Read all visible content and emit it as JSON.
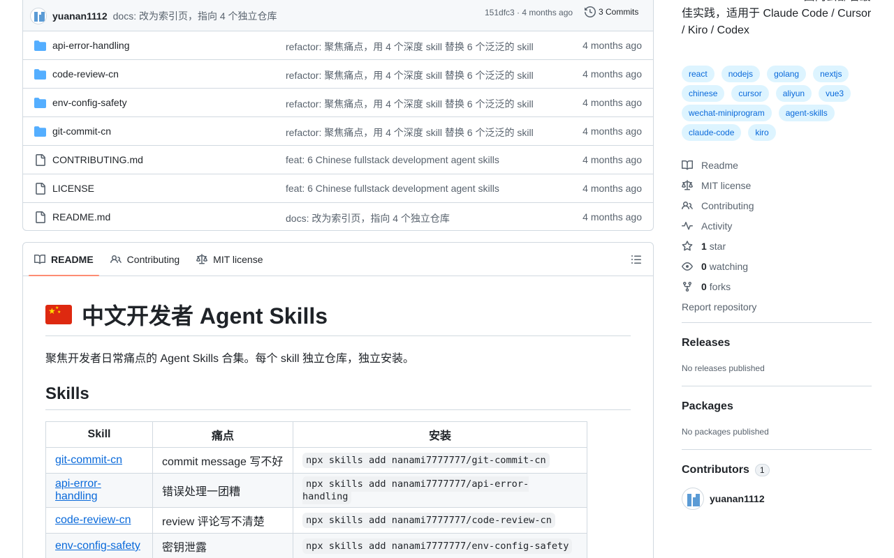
{
  "commit_bar": {
    "author": "yuanan1112",
    "message": "docs: 改为索引页，指向 4 个独立仓库",
    "meta": "151dfc3 · 4 months ago",
    "commits": "3 Commits"
  },
  "files": [
    {
      "name": "api-error-handling",
      "type": "dir",
      "commit": "refactor: 聚焦痛点，用 4 个深度 skill 替换 6 个泛泛的 skill",
      "time": "4 months ago"
    },
    {
      "name": "code-review-cn",
      "type": "dir",
      "commit": "refactor: 聚焦痛点，用 4 个深度 skill 替换 6 个泛泛的 skill",
      "time": "4 months ago"
    },
    {
      "name": "env-config-safety",
      "type": "dir",
      "commit": "refactor: 聚焦痛点，用 4 个深度 skill 替换 6 个泛泛的 skill",
      "time": "4 months ago"
    },
    {
      "name": "git-commit-cn",
      "type": "dir",
      "commit": "refactor: 聚焦痛点，用 4 个深度 skill 替换 6 个泛泛的 skill",
      "time": "4 months ago"
    },
    {
      "name": "CONTRIBUTING.md",
      "type": "file",
      "commit": "feat: 6 Chinese fullstack development agent skills",
      "time": "4 months ago"
    },
    {
      "name": "LICENSE",
      "type": "file",
      "commit": "feat: 6 Chinese fullstack development agent skills",
      "time": "4 months ago"
    },
    {
      "name": "README.md",
      "type": "file",
      "commit": "docs: 改为索引页，指向 4 个独立仓库",
      "time": "4 months ago"
    }
  ],
  "readme_tabs": [
    "README",
    "Contributing",
    "MIT license"
  ],
  "readme": {
    "title": "中文开发者 Agent Skills",
    "intro": "聚焦开发者日常痛点的 Agent Skills 合集。每个 skill 独立仓库，独立安装。",
    "skills_heading": "Skills",
    "table_headers": [
      "Skill",
      "痛点",
      "安装"
    ],
    "rows": [
      {
        "skill": "git-commit-cn",
        "pain": "commit message 写不好",
        "install": "npx skills add nanami7777777/git-commit-cn"
      },
      {
        "skill": "api-error-handling",
        "pain": "错误处理一团糟",
        "install": "npx skills add nanami7777777/api-error-handling"
      },
      {
        "skill": "code-review-cn",
        "pain": "review 评论写不清楚",
        "install": "npx skills add nanami7777777/code-review-cn"
      },
      {
        "skill": "env-config-safety",
        "pain": "密钥泄露",
        "install": "npx skills add nanami7777777/env-config-safety"
      }
    ]
  },
  "about": {
    "description_line1": "Vue/React + Node/Go + 国内云部署最",
    "description_line2": "佳实践，适用于 Claude Code / Cursor",
    "description_line3": "/ Kiro / Codex",
    "topics": [
      "react",
      "nodejs",
      "golang",
      "nextjs",
      "chinese",
      "cursor",
      "aliyun",
      "vue3",
      "wechat-miniprogram",
      "agent-skills",
      "claude-code",
      "kiro"
    ]
  },
  "meta": {
    "readme": "Readme",
    "license": "MIT license",
    "contributing": "Contributing",
    "activity": "Activity",
    "stars_count": "1",
    "stars_label": "star",
    "watching_count": "0",
    "watching_label": "watching",
    "forks_count": "0",
    "forks_label": "forks",
    "report": "Report repository"
  },
  "releases": {
    "title": "Releases",
    "sub": "No releases published"
  },
  "packages": {
    "title": "Packages",
    "sub": "No packages published"
  },
  "contributors": {
    "title": "Contributors",
    "count": "1",
    "name": "yuanan1112"
  },
  "colors": {
    "link": "#0969da",
    "muted": "#59636e",
    "folder": "#54aeff",
    "tab_underline": "#fd8c73",
    "topic_bg": "#ddf4ff"
  }
}
